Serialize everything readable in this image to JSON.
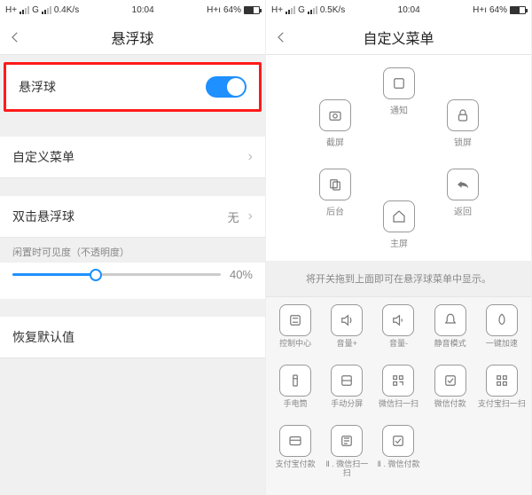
{
  "status": {
    "net": "H+",
    "carrier": "G",
    "signal": "ıııl",
    "speed_left": "0.4K/s",
    "time": "10:04",
    "speed_right": "0.5K/s",
    "batt_pct": "64%",
    "hplus": "H+ı"
  },
  "left": {
    "title": "悬浮球",
    "row_toggle": "悬浮球",
    "row_custom": "自定义菜单",
    "row_double": "双击悬浮球",
    "row_double_val": "无",
    "opacity_note": "闲置时可见度（不透明度）",
    "opacity_pct": "40%",
    "row_reset": "恢复默认值"
  },
  "right": {
    "title": "自定义菜单",
    "radial": {
      "top": "通知",
      "tl": "截屏",
      "tr": "锁屏",
      "bl": "后台",
      "br": "返回",
      "bottom": "主屏"
    },
    "hint": "将开关拖到上面即可在悬浮球菜单中显示。",
    "tray": [
      {
        "id": "control-center",
        "label": "控制中心"
      },
      {
        "id": "vol-up",
        "label": "音量+"
      },
      {
        "id": "vol-down",
        "label": "音量-"
      },
      {
        "id": "mute",
        "label": "静音模式"
      },
      {
        "id": "boost",
        "label": "一键加速"
      },
      {
        "id": "flashlight",
        "label": "手电筒"
      },
      {
        "id": "split",
        "label": "手动分屏"
      },
      {
        "id": "wx-scan",
        "label": "微信扫一扫"
      },
      {
        "id": "wx-pay",
        "label": "微信付款"
      },
      {
        "id": "ali-scan",
        "label": "支付宝扫一扫"
      },
      {
        "id": "ali-pay",
        "label": "支付宝付款"
      },
      {
        "id": "wx-scan2",
        "label": "Ⅱ . 微信扫一扫"
      },
      {
        "id": "wx-pay2",
        "label": "Ⅱ . 微信付款"
      }
    ]
  }
}
